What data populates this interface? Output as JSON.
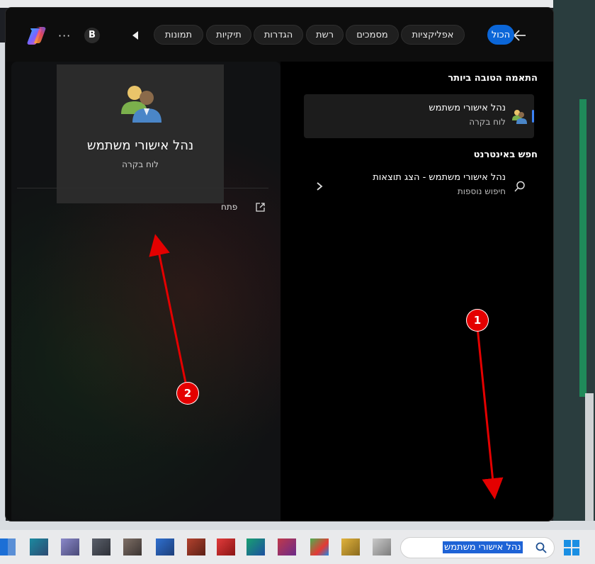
{
  "filters": {
    "back_label": "",
    "tabs": [
      {
        "label": "הכול",
        "active": true
      },
      {
        "label": "אפליקציות",
        "active": false
      },
      {
        "label": "מסמכים",
        "active": false
      },
      {
        "label": "רשת",
        "active": false
      },
      {
        "label": "הגדרות",
        "active": false
      },
      {
        "label": "תיקיות",
        "active": false
      },
      {
        "label": "תמונות",
        "active": false
      }
    ],
    "profile_initial": "B",
    "more_label": "···"
  },
  "results": {
    "best_match_title": "התאמה הטובה ביותר",
    "best_match": {
      "title": "נהל אישורי משתמש",
      "subtitle": "לוח בקרה"
    },
    "web_title": "חפש באינטרנט",
    "web_result": {
      "title": "נהל אישורי משתמש - הצג תוצאות",
      "subtitle": "חיפוש נוספות"
    }
  },
  "preview": {
    "title": "נהל אישורי משתמש",
    "subtitle": "לוח בקרה",
    "open_label": "פתח"
  },
  "annotations": {
    "badge_1": "1",
    "badge_2": "2"
  },
  "taskbar": {
    "search_value": "נהל אישורי משתמש"
  },
  "colors": {
    "accent": "#0b66d8",
    "annotation_red": "#e40000"
  }
}
